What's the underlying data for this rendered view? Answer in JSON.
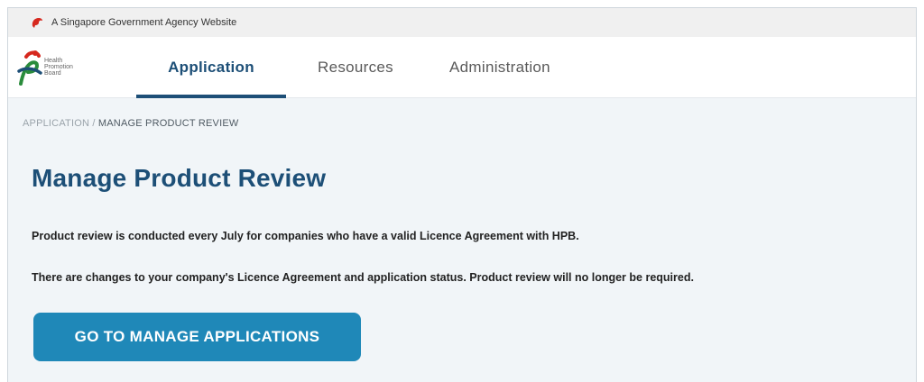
{
  "masthead": {
    "text": "A Singapore Government Agency Website"
  },
  "logo": {
    "line1": "Health",
    "line2": "Promotion",
    "line3": "Board"
  },
  "nav": {
    "application": "Application",
    "resources": "Resources",
    "administration": "Administration"
  },
  "breadcrumb": {
    "parent": "APPLICATION /",
    "current": "MANAGE PRODUCT REVIEW"
  },
  "page": {
    "title": "Manage Product Review",
    "paragraph1": "Product review is conducted every July for companies who have a valid Licence Agreement with HPB.",
    "paragraph2": "There are changes to your company's Licence Agreement and application status. Product review will no longer be required.",
    "cta_label": "GO TO MANAGE APPLICATIONS"
  },
  "colors": {
    "brand": "#1d4f77",
    "button": "#1f88b8",
    "page_bg": "#f1f5f8"
  }
}
